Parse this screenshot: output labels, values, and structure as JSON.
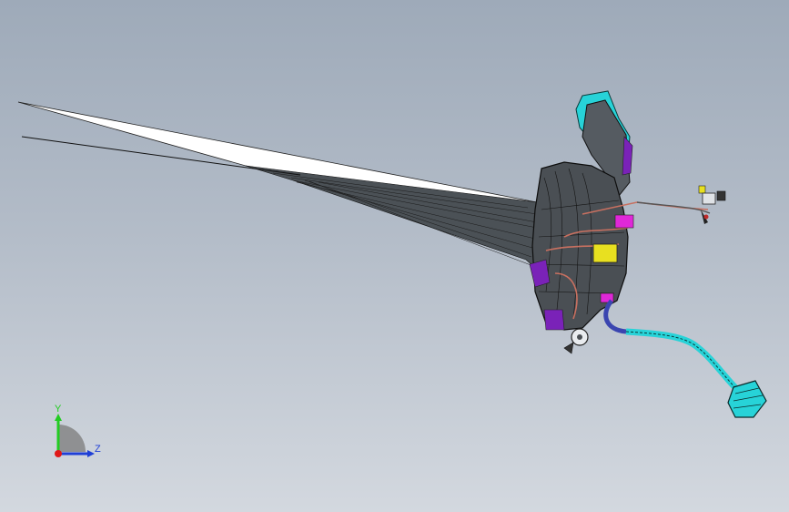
{
  "viewport": {
    "background_top": "#9eaab9",
    "background_bottom": "#d3d8df"
  },
  "triad": {
    "y_label": "Y",
    "z_label": "Z",
    "y_color": "#22cc22",
    "z_color": "#1f3fd6",
    "x_color": "#e01818"
  },
  "model": {
    "colors": {
      "body": "#4a4f54",
      "edges": "#111111",
      "cyan": "#27d3d8",
      "magenta": "#e028d8",
      "purple": "#7a22b8",
      "yellow": "#e8e020",
      "copper": "#c87060",
      "sheet_white": "#ffffff",
      "sheet_dark": "#4b5156"
    }
  }
}
